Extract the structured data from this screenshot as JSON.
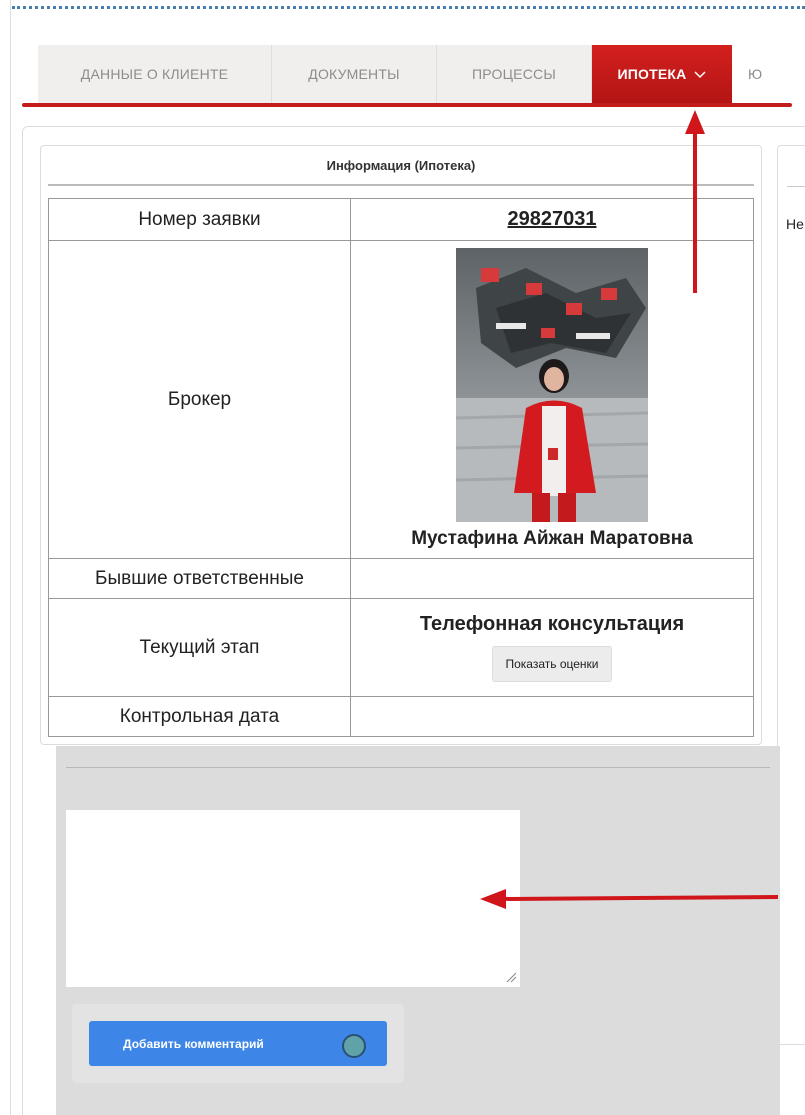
{
  "tabs": [
    {
      "label": "ДАННЫЕ О КЛИЕНТЕ",
      "active": false
    },
    {
      "label": "ДОКУМЕНТЫ",
      "active": false
    },
    {
      "label": "ПРОЦЕССЫ",
      "active": false
    },
    {
      "label": "ИПОТЕКА",
      "active": true
    },
    {
      "label": "Ю",
      "active": false
    }
  ],
  "info": {
    "title": "Информация (Ипотека)",
    "rows": {
      "application_number_label": "Номер заявки",
      "application_number_value": "29827031",
      "broker_label": "Брокер",
      "broker_name": "Мустафина Айжан Маратовна",
      "former_responsible_label": "Бывшие ответственные",
      "former_responsible_value": "",
      "current_stage_label": "Текущий этап",
      "current_stage_value": "Телефонная консультация",
      "show_ratings_button": "Показать оценки",
      "control_date_label": "Контрольная дата",
      "control_date_value": ""
    }
  },
  "right_panel": {
    "text": "Не"
  },
  "comment": {
    "placeholder": "",
    "add_button": "Добавить комментарий"
  },
  "icons": {
    "tab_dropdown": "chevron-down-icon",
    "annotation_arrows": "red-arrow-icon",
    "loading": "spinner-icon",
    "resize": "resize-grip-icon"
  },
  "colors": {
    "active_tab": "#c21c1b",
    "button_primary": "#3d85e6",
    "annotation": "#d0161a"
  }
}
